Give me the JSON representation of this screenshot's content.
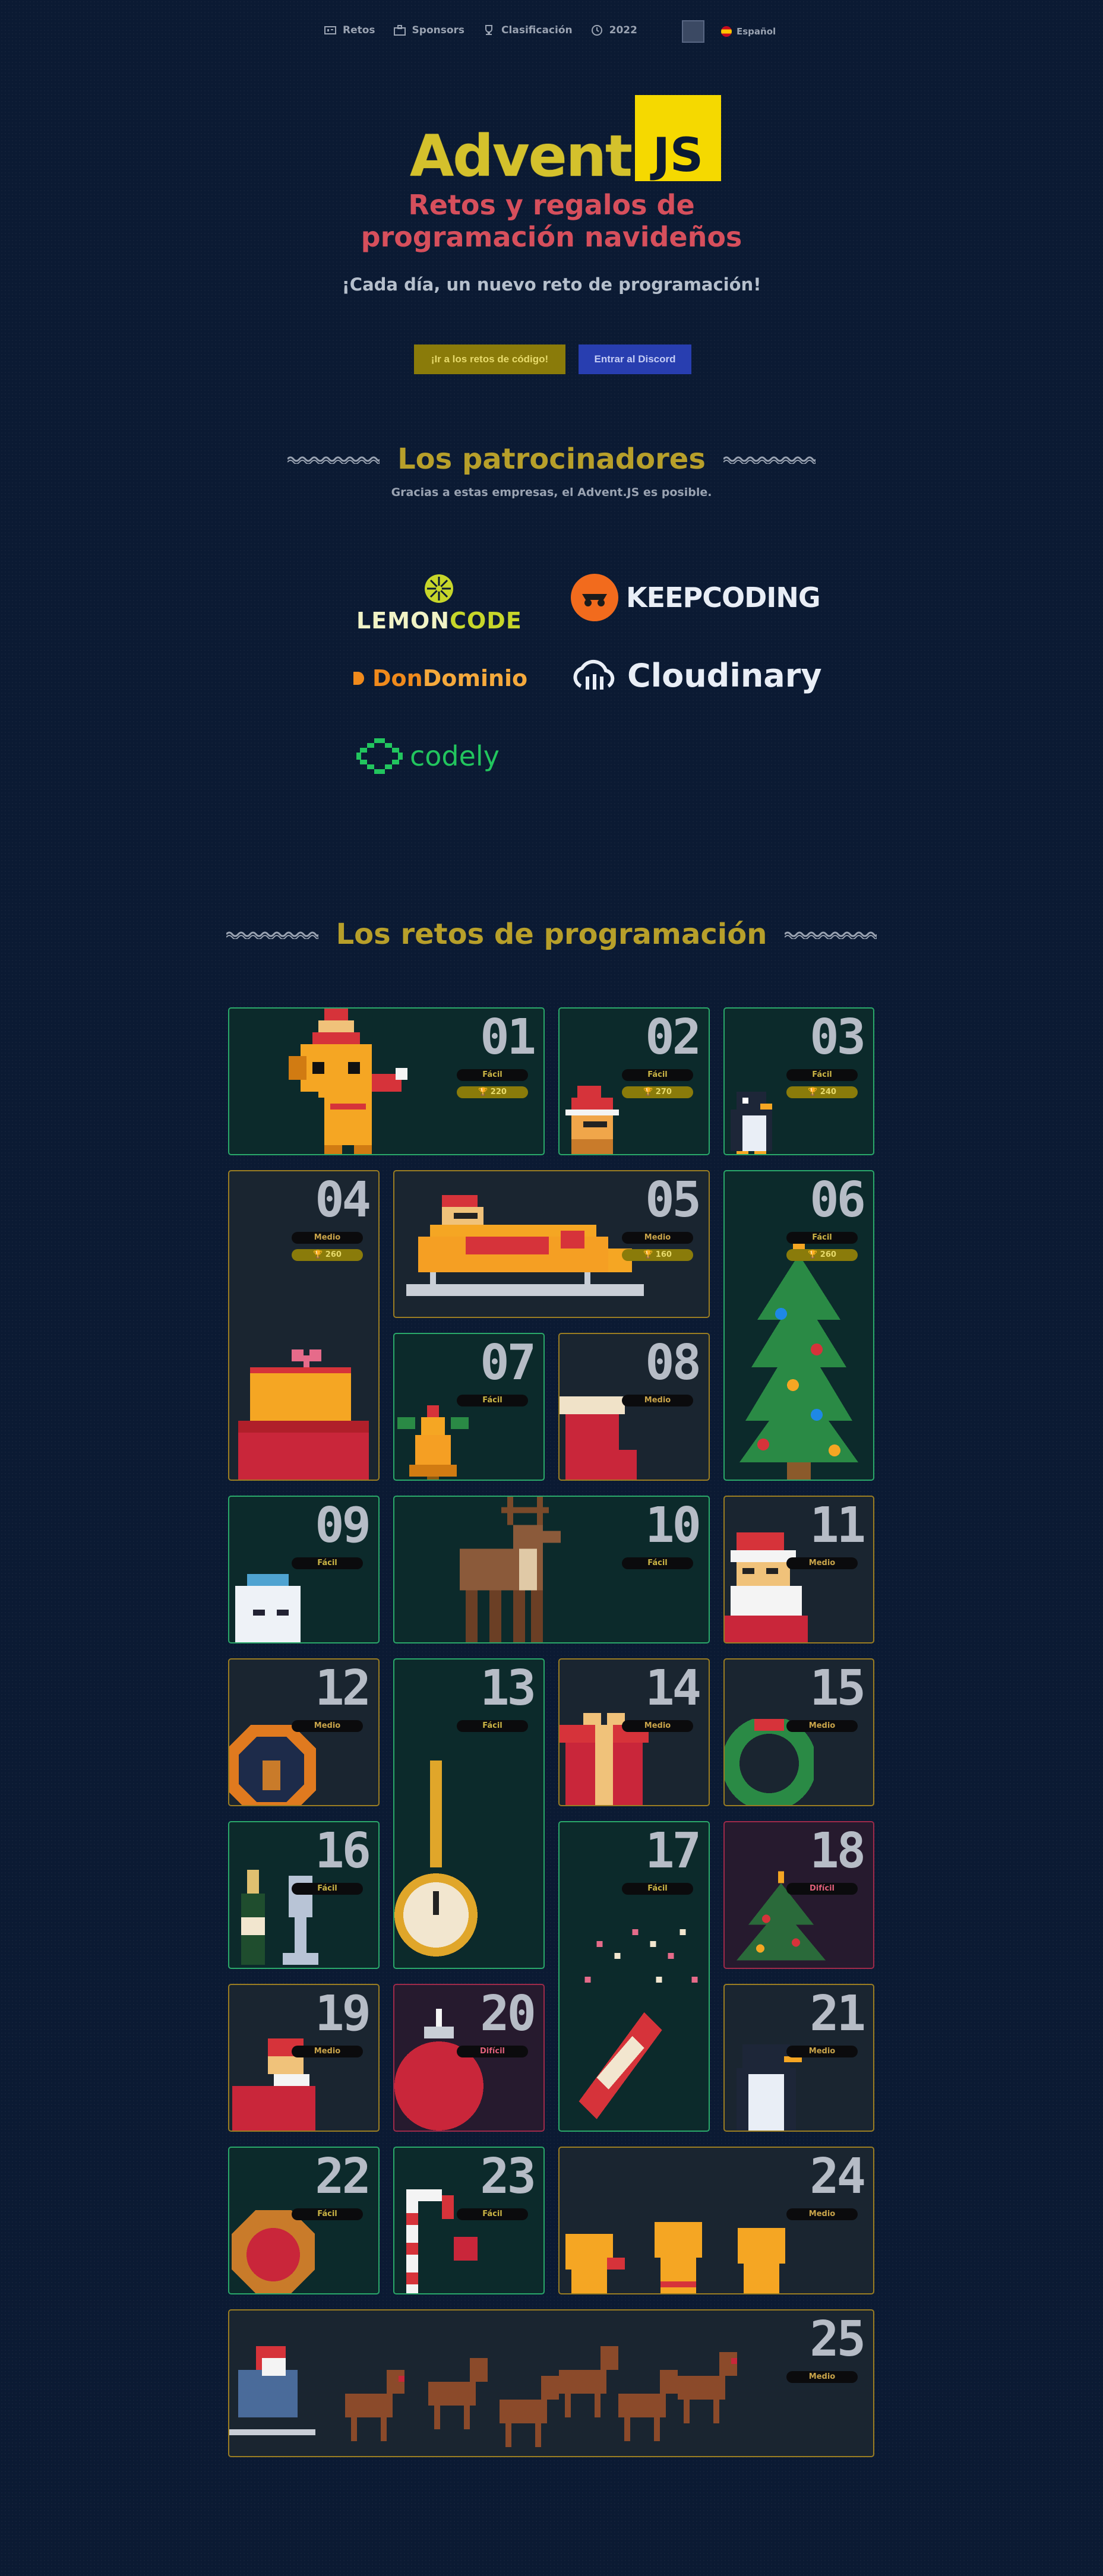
{
  "nav": {
    "items": [
      {
        "label": "Retos",
        "icon": "retos-icon"
      },
      {
        "label": "Sponsors",
        "icon": "sponsors-icon"
      },
      {
        "label": "Clasificación",
        "icon": "trophy-icon"
      },
      {
        "label": "2022",
        "icon": "history-icon"
      }
    ],
    "language": "Español"
  },
  "hero": {
    "logo_text": "Advent",
    "logo_badge": "JS",
    "subtitle_line1": "Retos y regalos de",
    "subtitle_line2": "programación navideños",
    "tagline": "¡Cada día, un nuevo reto de programación!",
    "cta_code": "¡Ir a los retos de código!",
    "cta_discord": "Entrar al Discord"
  },
  "sponsors": {
    "title": "Los patrocinadores",
    "subtitle": "Gracias a estas empresas, el Advent.JS es posible.",
    "logos": {
      "lemon": {
        "part1": "LEMON",
        "part2": "CODE"
      },
      "keep": "KEEPCODING",
      "don": {
        "part1": "Don",
        "part2": "Dominio"
      },
      "cloud": "Cloudinary",
      "codely": "codely"
    }
  },
  "challenges": {
    "title": "Los retos de programación",
    "days": [
      {
        "num": "01",
        "difficulty": "Fácil",
        "score": "220"
      },
      {
        "num": "02",
        "difficulty": "Fácil",
        "score": "270"
      },
      {
        "num": "03",
        "difficulty": "Fácil",
        "score": "240"
      },
      {
        "num": "04",
        "difficulty": "Medio",
        "score": "260"
      },
      {
        "num": "05",
        "difficulty": "Medio",
        "score": "160"
      },
      {
        "num": "06",
        "difficulty": "Fácil",
        "score": "260"
      },
      {
        "num": "07",
        "difficulty": "Fácil"
      },
      {
        "num": "08",
        "difficulty": "Medio"
      },
      {
        "num": "09",
        "difficulty": "Fácil"
      },
      {
        "num": "10",
        "difficulty": "Fácil"
      },
      {
        "num": "11",
        "difficulty": "Medio"
      },
      {
        "num": "12",
        "difficulty": "Medio"
      },
      {
        "num": "13",
        "difficulty": "Fácil"
      },
      {
        "num": "14",
        "difficulty": "Medio"
      },
      {
        "num": "15",
        "difficulty": "Medio"
      },
      {
        "num": "16",
        "difficulty": "Fácil"
      },
      {
        "num": "17",
        "difficulty": "Fácil"
      },
      {
        "num": "18",
        "difficulty": "Difícil"
      },
      {
        "num": "19",
        "difficulty": "Medio"
      },
      {
        "num": "20",
        "difficulty": "Difícil"
      },
      {
        "num": "21",
        "difficulty": "Medio"
      },
      {
        "num": "22",
        "difficulty": "Fácil"
      },
      {
        "num": "23",
        "difficulty": "Fácil"
      },
      {
        "num": "24",
        "difficulty": "Medio"
      },
      {
        "num": "25",
        "difficulty": "Medio"
      }
    ]
  },
  "colors": {
    "background": "#0b1a33",
    "gold": "#b79f2a",
    "red": "#d64f5c",
    "easy_border": "#2aa86a",
    "medium_border": "#9a7d22",
    "hard_border": "#9e2a4a"
  }
}
